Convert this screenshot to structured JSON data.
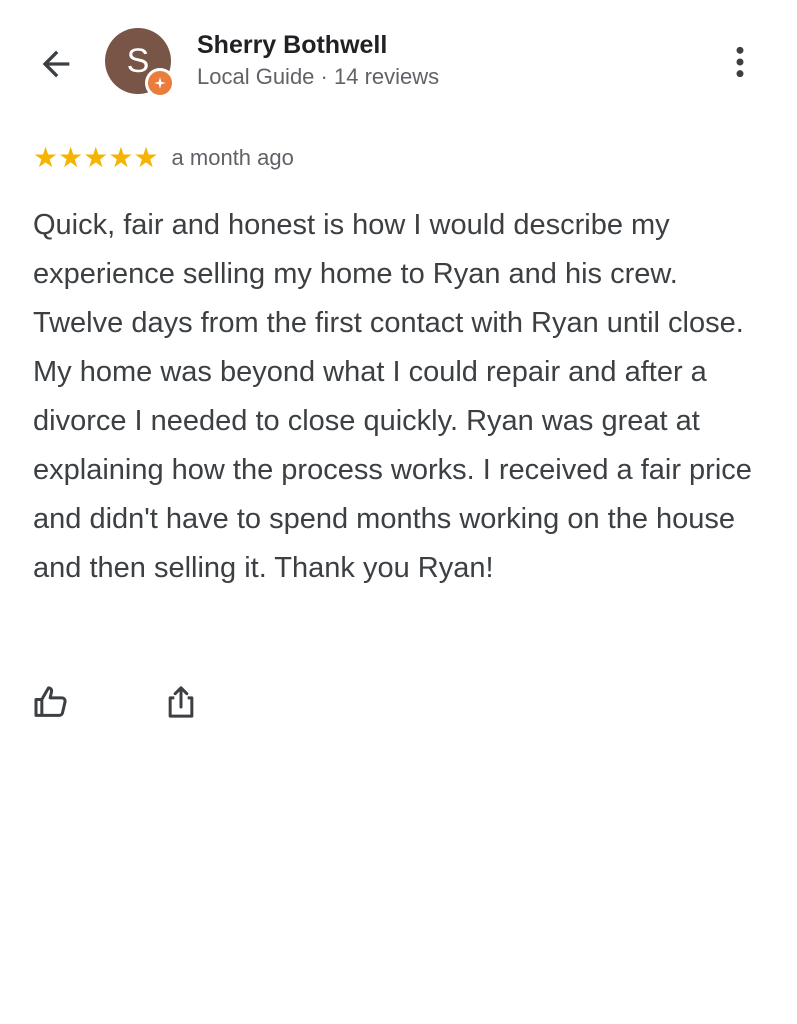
{
  "header": {
    "back_icon": "arrow-back-icon",
    "avatar_initial": "S",
    "author_name": "Sherry Bothwell",
    "author_level": "Local Guide",
    "separator": " · ",
    "review_count": "14 reviews",
    "more_icon": "more-vert-icon"
  },
  "review": {
    "rating": 5,
    "rating_max": 5,
    "date": "a month ago",
    "text": "Quick, fair and honest is how I would describe my experience selling my home to Ryan and his crew. Twelve days from the first contact with Ryan until close. My home was beyond what I could repair and after a divorce I needed to close quickly. Ryan was great at explaining how the process works. I received a fair price and didn't have to spend months working on the house and then selling it. Thank you Ryan!"
  },
  "actions": {
    "like_icon": "thumbs-up-icon",
    "share_icon": "share-icon"
  },
  "colors": {
    "star": "#f5b400",
    "avatar_bg": "#795548",
    "guide_badge": "#ea7c3c",
    "text_primary": "#202124",
    "text_secondary": "#5f6368"
  }
}
